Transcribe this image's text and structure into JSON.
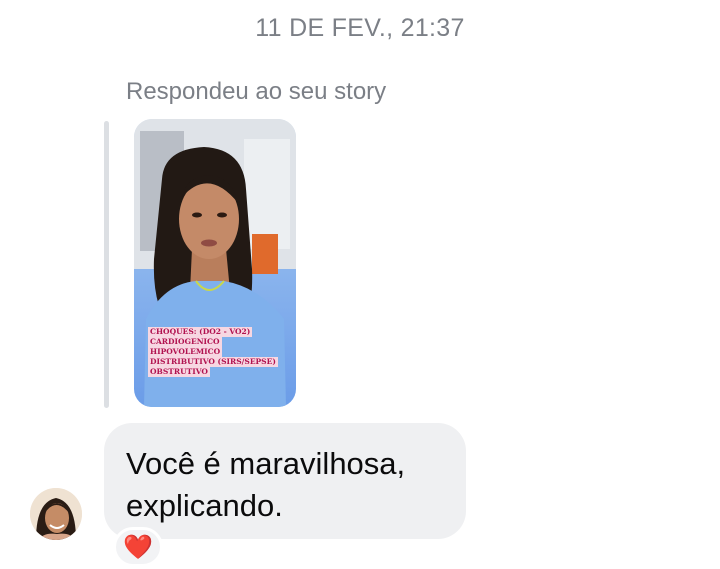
{
  "timestamp": "11 DE FEV., 21:37",
  "reply_label": "Respondeu ao seu story",
  "story": {
    "caption_lines": [
      "CHOQUES: (DO2 - VO2)",
      "CARDIOGENICO",
      "HIPOVOLEMICO",
      "DISTRIBUTIVO (SIRS/SEPSE)",
      "OBSTRUTIVO"
    ]
  },
  "message": {
    "line1": "Você é maravilhosa,",
    "line2": "explicando."
  },
  "reaction": {
    "emoji": "❤️",
    "color": "#e0243a"
  },
  "icons": {
    "avatar": "sender-avatar",
    "reaction": "heart-icon"
  }
}
